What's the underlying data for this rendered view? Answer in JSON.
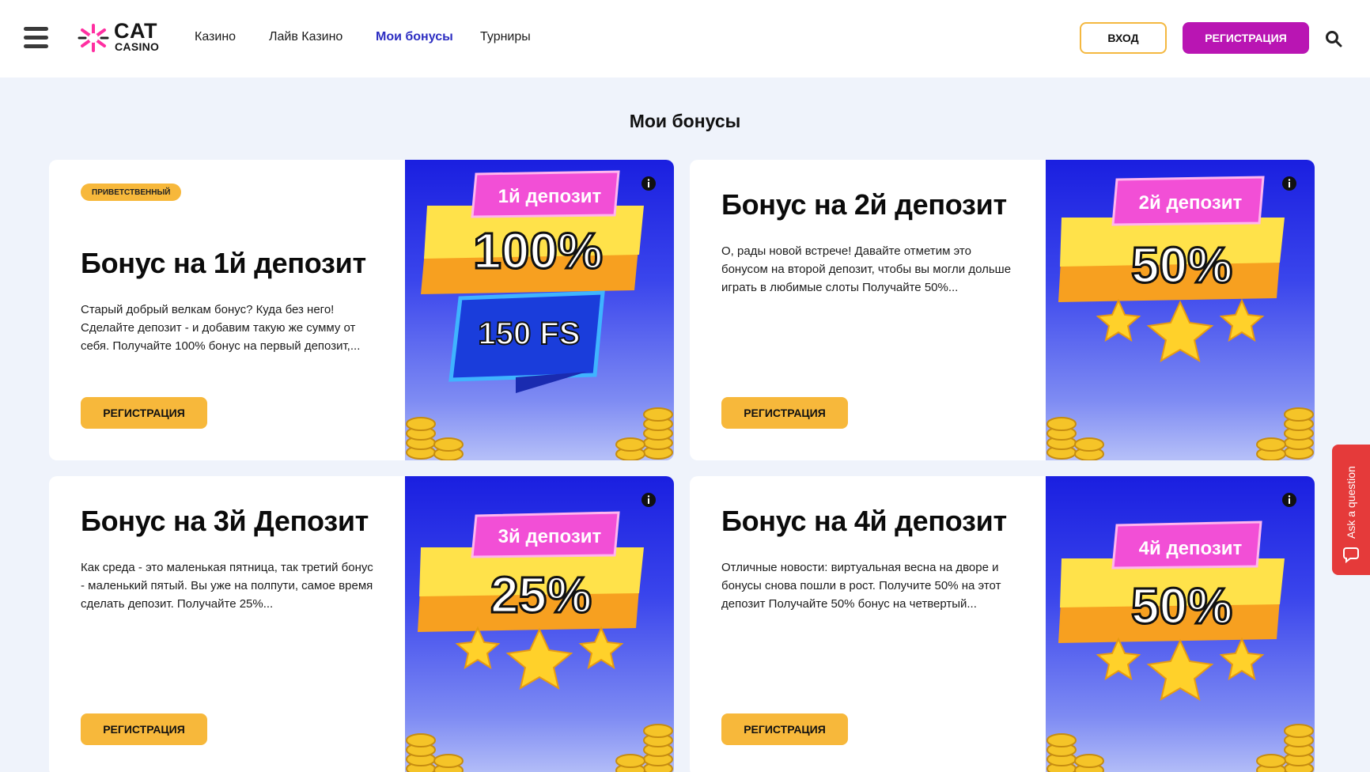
{
  "header": {
    "logo": {
      "cat": "CAT",
      "casino": "CASINO"
    },
    "nav": [
      {
        "label": "Казино",
        "active": false
      },
      {
        "label": "Лайв Казино",
        "active": false
      },
      {
        "label": "Мои бонусы",
        "active": true
      },
      {
        "label": "Турниры",
        "active": false
      }
    ],
    "login_label": "ВХОД",
    "register_label": "РЕГИСТРАЦИЯ",
    "menu_icon": "hamburger-icon",
    "search_icon": "search-icon"
  },
  "page_title": "Мои бонусы",
  "bonuses": [
    {
      "badge": "ПРИВЕТСТВЕННЫЙ",
      "title": "Бонус на 1й депозит",
      "description": "Старый добрый велкам бонус? Куда без него! Сделайте депозит - и добавим такую же сумму от себя. Получайте 100% бонус на первый депозит,...",
      "button": "РЕГИСТРАЦИЯ",
      "art": {
        "tag": "1й депозит",
        "amount": "100%",
        "extra": "150 FS"
      }
    },
    {
      "badge": "",
      "title": "Бонус на 2й депозит",
      "description": "О, рады новой встрече! Давайте отметим это бонусом на второй депозит, чтобы вы могли дольше играть в любимые слоты Получайте 50%...",
      "button": "РЕГИСТРАЦИЯ",
      "art": {
        "tag": "2й депозит",
        "amount": "50%",
        "extra": ""
      }
    },
    {
      "badge": "",
      "title": "Бонус на 3й Депозит",
      "description": "Как среда - это маленькая пятница, так третий бонус - маленький пятый. Вы уже на полпути, самое время сделать депозит. Получайте 25%...",
      "button": "РЕГИСТРАЦИЯ",
      "art": {
        "tag": "3й депозит",
        "amount": "25%",
        "extra": ""
      }
    },
    {
      "badge": "",
      "title": "Бонус на 4й депозит",
      "description": "Отличные новости: виртуальная весна на дворе и бонусы снова пошли в рост. Получите 50% на этот депозит Получайте 50% бонус на четвертый...",
      "button": "РЕГИСТРАЦИЯ",
      "art": {
        "tag": "4й депозит",
        "amount": "50%",
        "extra": ""
      }
    }
  ],
  "ask_question": "Ask a question",
  "colors": {
    "accent_yellow": "#f7b83b",
    "brand_magenta": "#b915b3",
    "nav_active": "#2d2ec2",
    "ask_red": "#e53a3a"
  }
}
